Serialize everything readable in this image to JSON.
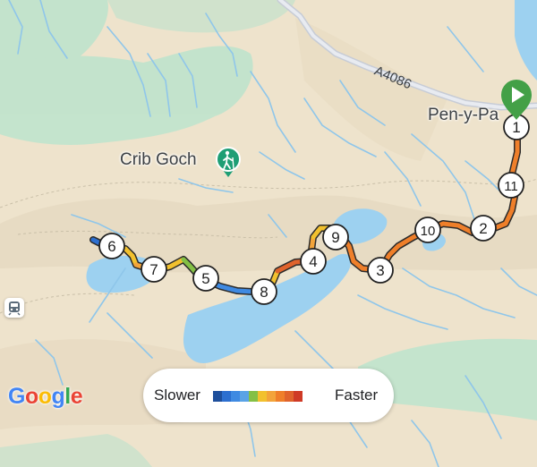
{
  "map": {
    "places": {
      "peak": "Crib Goch",
      "village": "Pen-y-Pa"
    },
    "road_label": "A4086",
    "attribution": [
      "G",
      "o",
      "o",
      "g",
      "l",
      "e"
    ],
    "attribution_colors": [
      "#4285f4",
      "#ea4335",
      "#fbbc05",
      "#4285f4",
      "#34a853",
      "#ea4335"
    ],
    "icons": {
      "hiking": "hiking-person-icon",
      "start": "green-start-flag-icon",
      "rail": "train-station-icon"
    }
  },
  "route": {
    "markers": [
      "1",
      "2",
      "3",
      "4",
      "5",
      "6",
      "7",
      "8",
      "9",
      "10",
      "11"
    ],
    "speed_palette": [
      "#1e4f9c",
      "#2c6fd0",
      "#3f8ae2",
      "#5aa3e6",
      "#84c045",
      "#f2c12e",
      "#f3a43a",
      "#ef7f2a",
      "#e0632c",
      "#cf3a26"
    ]
  },
  "legend": {
    "slower": "Slower",
    "faster": "Faster"
  }
}
